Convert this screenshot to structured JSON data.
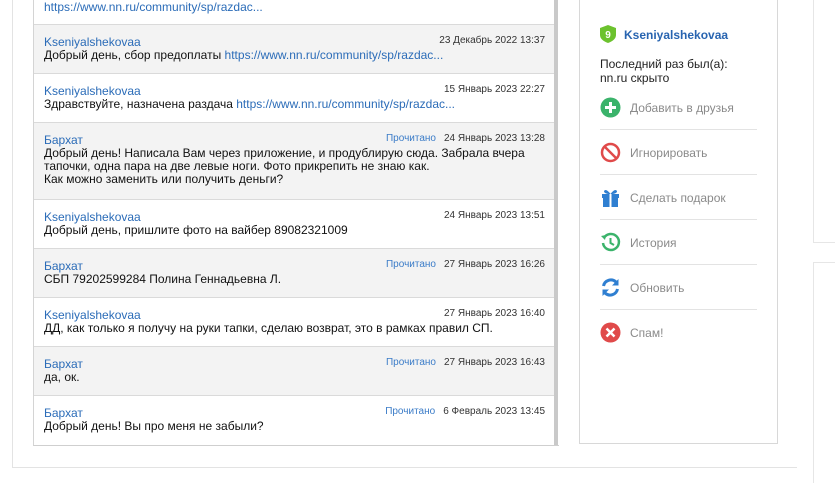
{
  "top_link": "https://www.nn.ru/community/sp/razdac...",
  "messages": [
    {
      "author": "Kseniyalshekovaa",
      "read": "",
      "date": "23 Декабрь 2022 13:37",
      "text": "Добрый день, сбор предоплаты ",
      "link": "https://www.nn.ru/community/sp/razdac..."
    },
    {
      "author": "Kseniyalshekovaa",
      "read": "",
      "date": "15 Январь 2023 22:27",
      "text": "Здравствуйте, назначена раздача ",
      "link": "https://www.nn.ru/community/sp/razdac..."
    },
    {
      "author": "Бархат",
      "read": "Прочитано",
      "date": "24 Январь 2023 13:28",
      "text_lines": [
        "Добрый день! Написала Вам через приложение, и продублирую сюда. Забрала вчера",
        "тапочки, одна пара на две левые ноги. Фото прикрепить не знаю как.",
        "Как можно заменить или получить деньги?"
      ]
    },
    {
      "author": "Kseniyalshekovaa",
      "read": "",
      "date": "24 Январь 2023 13:51",
      "text": "Добрый день, пришлите фото на вайбер 89082321009"
    },
    {
      "author": "Бархат",
      "read": "Прочитано",
      "date": "27 Январь 2023 16:26",
      "text": "СБП 79202599284 Полина Геннадьевна Л."
    },
    {
      "author": "Kseniyalshekovaa",
      "read": "",
      "date": "27 Январь 2023 16:40",
      "text": "ДД, как только я получу на руки тапки, сделаю возврат, это в рамках правил СП."
    },
    {
      "author": "Бархат",
      "read": "Прочитано",
      "date": "27 Январь 2023 16:43",
      "text": "да, ок."
    },
    {
      "author": "Бархат",
      "read": "Прочитано",
      "date": "6 Февраль 2023 13:45",
      "text": "Добрый день! Вы про меня не забыли?"
    }
  ],
  "profile": {
    "badge_number": "9",
    "username": "Kseniyalshekovaa",
    "last_seen_label": "Последний раз был(а):",
    "last_seen_value": "nn.ru скрыто",
    "actions": [
      {
        "label": "Добавить в друзья",
        "icon": "add-friend-icon",
        "color": "#3bb36b"
      },
      {
        "label": "Игнорировать",
        "icon": "ignore-icon",
        "color": "#e04a4a"
      },
      {
        "label": "Сделать подарок",
        "icon": "gift-icon",
        "color": "#2f7fd1"
      },
      {
        "label": "История",
        "icon": "history-icon",
        "color": "#3bb36b"
      },
      {
        "label": "Обновить",
        "icon": "refresh-icon",
        "color": "#2f7fd1"
      },
      {
        "label": "Спам!",
        "icon": "spam-icon",
        "color": "#e04a4a"
      }
    ]
  }
}
